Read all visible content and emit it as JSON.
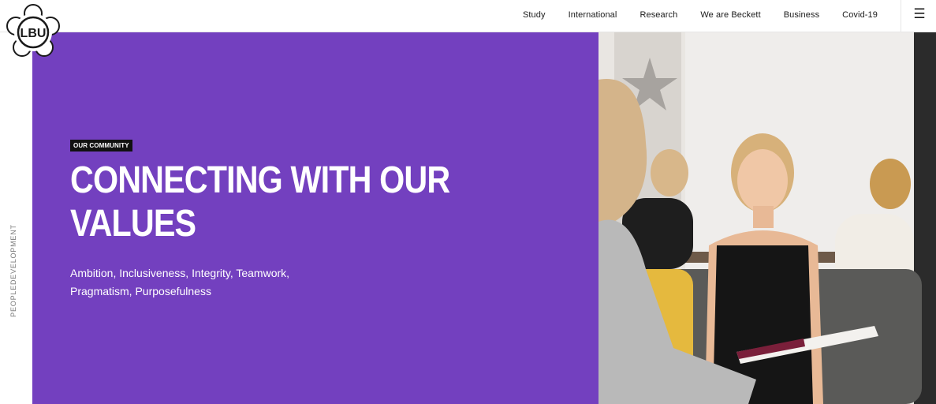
{
  "nav": {
    "items": [
      {
        "label": "Study"
      },
      {
        "label": "International"
      },
      {
        "label": "Research"
      },
      {
        "label": "We are Beckett"
      },
      {
        "label": "Business"
      },
      {
        "label": "Covid-19"
      }
    ],
    "menu_icon": "hamburger-icon",
    "menu_glyph": "☰"
  },
  "logo": {
    "text": "LBU",
    "icon": "rose-seal-logo"
  },
  "side_label": "PEOPLEDEVELOPMENT",
  "hero": {
    "eyebrow": "OUR COMMUNITY",
    "title": "CONNECTING WITH OUR VALUES",
    "subtitle": "Ambition, Inclusiveness, Integrity, Teamwork, Pragmatism, Purposefulness"
  },
  "colors": {
    "hero_purple": "#7340bf",
    "eyebrow_bg": "#111111",
    "text_dark": "#1a1a1a"
  }
}
